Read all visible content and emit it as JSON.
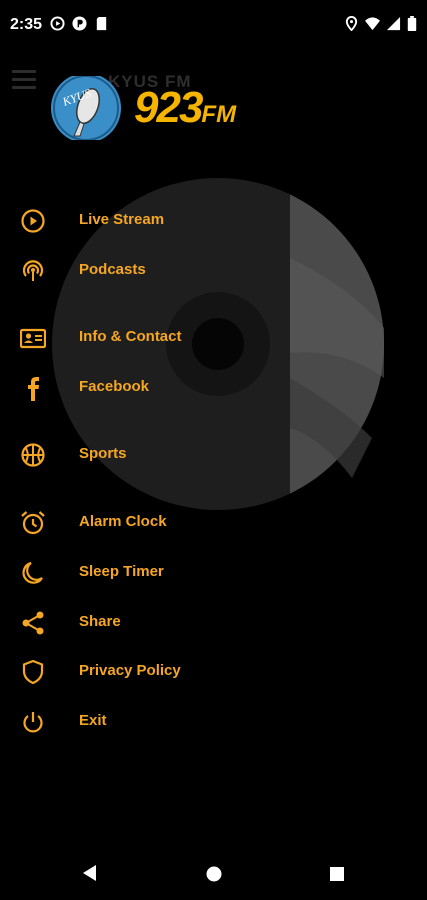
{
  "status_bar": {
    "time": "2:35",
    "left_icons": [
      "play-circle-icon",
      "p-badge-icon",
      "sd-card-icon"
    ],
    "right_icons": [
      "location-icon",
      "wifi-icon",
      "signal-icon",
      "battery-icon"
    ]
  },
  "header": {
    "ghost_title": "KYUS FM",
    "logo_brand_text": "KYUS",
    "logo_frequency": "923",
    "logo_suffix": "FM"
  },
  "menu": {
    "items": [
      {
        "label": "Live Stream",
        "icon": "play-circle-icon"
      },
      {
        "label": "Podcasts",
        "icon": "podcast-icon"
      },
      {
        "label": "Info & Contact",
        "icon": "contact-card-icon"
      },
      {
        "label": "Facebook",
        "icon": "facebook-icon"
      },
      {
        "label": "Sports",
        "icon": "basketball-icon"
      },
      {
        "label": "Alarm Clock",
        "icon": "alarm-clock-icon"
      },
      {
        "label": "Sleep Timer",
        "icon": "moon-icon"
      },
      {
        "label": "Share",
        "icon": "share-icon"
      },
      {
        "label": "Privacy Policy",
        "icon": "shield-icon"
      },
      {
        "label": "Exit",
        "icon": "power-icon"
      }
    ]
  },
  "colors": {
    "accent": "#f5a623",
    "background": "#000000",
    "logo_circle": "#3a8fc9"
  },
  "nav_bar": [
    "back-icon",
    "home-icon",
    "recents-icon"
  ]
}
